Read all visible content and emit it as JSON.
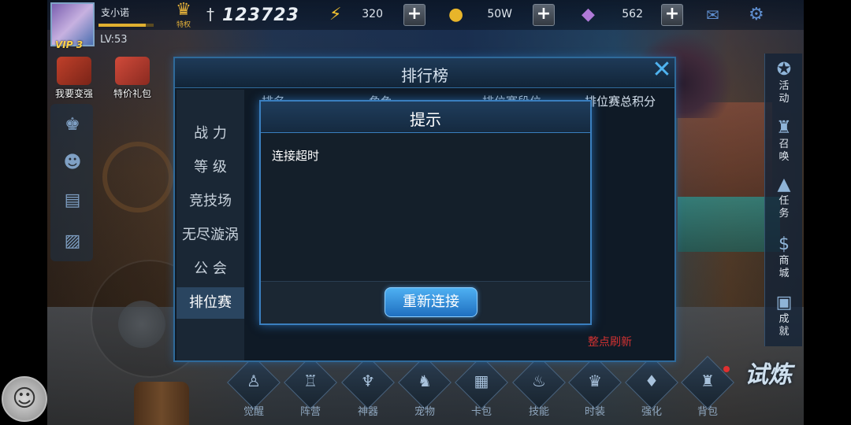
{
  "player": {
    "vip": "VIP 3",
    "name": "支小诺",
    "level": "LV:53",
    "privilege_label": "特权",
    "power": "123723",
    "xp_progress": 0.85
  },
  "resources": {
    "stamina": "320",
    "gold": "50W",
    "gems": "562"
  },
  "left_menu": {
    "upgrade": "我要变强",
    "gift": "特价礼包"
  },
  "right_nav": [
    {
      "label": "活\n动"
    },
    {
      "label": "召\n唤"
    },
    {
      "label": "任\n务"
    },
    {
      "label": "商\n城"
    },
    {
      "label": "成\n就"
    }
  ],
  "bottom_nav": [
    {
      "label": "觉醒"
    },
    {
      "label": "阵营"
    },
    {
      "label": "神器"
    },
    {
      "label": "宠物"
    },
    {
      "label": "卡包"
    },
    {
      "label": "技能"
    },
    {
      "label": "时装"
    },
    {
      "label": "强化"
    },
    {
      "label": "背包"
    }
  ],
  "trial_label": "试炼",
  "leaderboard": {
    "title": "排行榜",
    "tabs": [
      "战 力",
      "等 级",
      "竞技场",
      "无尽漩涡",
      "公 会",
      "排位赛"
    ],
    "columns": [
      "排名",
      "角色",
      "排位赛段位",
      "排位赛总积分"
    ],
    "refresh_note": "整点刷新"
  },
  "dialog": {
    "title": "提示",
    "message": "连接超时",
    "button": "重新连接"
  }
}
